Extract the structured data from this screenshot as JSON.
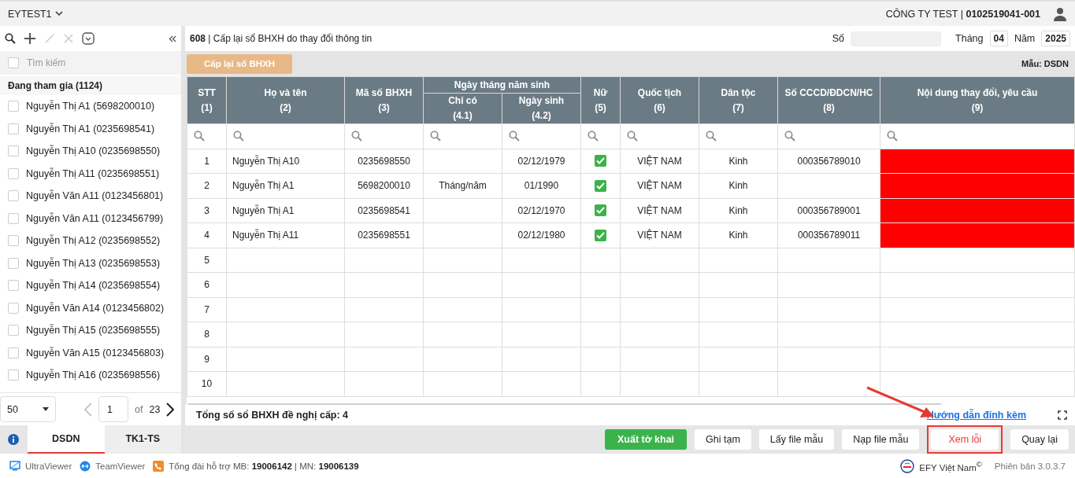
{
  "header": {
    "org_selector": "EYTEST1",
    "company": "CÔNG TY TEST | **0102519041-001**"
  },
  "sidebar": {
    "search_placeholder": "Tìm kiếm",
    "group": "Đang tham gia (1124)",
    "items": [
      {
        "label": "Nguyễn Thị A1 (5698200010)",
        "checked": false
      },
      {
        "label": "Nguyễn Thị A1 (0235698541)",
        "checked": false
      },
      {
        "label": "Nguyễn Thị A10 (0235698550)",
        "checked": false
      },
      {
        "label": "Nguyễn Thị A11 (0235698551)",
        "checked": false
      },
      {
        "label": "Nguyễn Văn A11 (0123456801)",
        "checked": false
      },
      {
        "label": "Nguyễn Văn A11 (0123456799)",
        "checked": false
      },
      {
        "label": "Nguyễn Thị A12 (0235698552)",
        "checked": false
      },
      {
        "label": "Nguyễn Thị A13 (0235698553)",
        "checked": false
      },
      {
        "label": "Nguyễn Thị A14 (0235698554)",
        "checked": false
      },
      {
        "label": "Nguyễn Văn A14 (0123456802)",
        "checked": false
      },
      {
        "label": "Nguyễn Thị A15 (0235698555)",
        "checked": false
      },
      {
        "label": "Nguyễn Văn A15 (0123456803)",
        "checked": false
      },
      {
        "label": "Nguyễn Thị A16 (0235698556)",
        "checked": false
      }
    ],
    "pager": {
      "page_size": "50",
      "page": "1",
      "of_label": "of",
      "total_pages": "23"
    }
  },
  "bottom_tabs": [
    {
      "label": "DSDN",
      "selected": true
    },
    {
      "label": "TK1-TS",
      "selected": false
    }
  ],
  "form": {
    "title": "**608** | Cấp lại sổ BHXH do thay đổi thông tin",
    "so_label": "Số",
    "thang_label": "Tháng",
    "thang": "04",
    "nam_label": "Năm",
    "nam": "2025",
    "action_button": "Cấp lại sổ BHXH",
    "template_label": "Mẫu: DSDN"
  },
  "table": {
    "columns": [
      {
        "label": "STT",
        "number": "(1)"
      },
      {
        "label": "Họ và tên",
        "number": "(2)"
      },
      {
        "label": "Mã số BHXH",
        "number": "(3)"
      },
      {
        "label": "Ngày tháng năm sinh",
        "children": [
          {
            "label": "Chỉ có",
            "number": "(4.1)"
          },
          {
            "label": "Ngày sinh",
            "number": "(4.2)"
          }
        ]
      },
      {
        "label": "Nữ",
        "number": "(5)"
      },
      {
        "label": "Quốc tịch",
        "number": "(6)"
      },
      {
        "label": "Dân tộc",
        "number": "(7)"
      },
      {
        "label": "Số CCCD/ĐDCN/HC",
        "number": "(8)"
      },
      {
        "label": "Nội dung thay đổi, yêu cầu",
        "number": "(9)"
      }
    ],
    "rows": [
      {
        "stt": "1",
        "name": "Nguyễn Thị A10",
        "bhxh": "0235698550",
        "dob": "02/12/1979",
        "female": true,
        "nationality": "VIỆT NAM",
        "ethnicity": "Kinh",
        "id_number": "000356789010",
        "flagged": true
      },
      {
        "stt": "2",
        "name": "Nguyễn Thị A1",
        "bhxh": "5698200010",
        "partial_date": "Tháng/năm",
        "dob": "01/1990",
        "female": true,
        "nationality": "VIỆT NAM",
        "ethnicity": "Kinh",
        "flagged": true
      },
      {
        "stt": "3",
        "name": "Nguyễn Thị A1",
        "bhxh": "0235698541",
        "dob": "02/12/1970",
        "female": true,
        "nationality": "VIỆT NAM",
        "ethnicity": "Kinh",
        "id_number": "000356789001",
        "flagged": true
      },
      {
        "stt": "4",
        "name": "Nguyễn Thị A11",
        "bhxh": "0235698551",
        "dob": "02/12/1980",
        "female": true,
        "nationality": "VIỆT NAM",
        "ethnicity": "Kinh",
        "id_number": "000356789011",
        "flagged": true
      },
      {
        "stt": "5",
        "female": false,
        "flagged": false
      },
      {
        "stt": "6",
        "female": false,
        "flagged": false
      },
      {
        "stt": "7",
        "female": false,
        "flagged": false
      },
      {
        "stt": "8",
        "female": false,
        "flagged": false
      },
      {
        "stt": "9",
        "female": false,
        "flagged": false
      },
      {
        "stt": "10",
        "female": false,
        "flagged": false
      }
    ],
    "total": "Tổng số sổ BHXH đề nghị cấp: 4",
    "guide_link": "Hướng dẫn đính kèm"
  },
  "actions": [
    {
      "label": "Xuất tờ khai",
      "kind": "primary",
      "highlighted": false
    },
    {
      "label": "Ghi tạm",
      "kind": "default",
      "highlighted": false
    },
    {
      "label": "Lấy file mẫu",
      "kind": "default",
      "highlighted": false
    },
    {
      "label": "Nạp file mẫu",
      "kind": "default",
      "highlighted": false
    },
    {
      "label": "Xem lỗi",
      "kind": "danger",
      "highlighted": true
    },
    {
      "label": "Quay lại",
      "kind": "default",
      "highlighted": false
    }
  ],
  "footer": {
    "links": [
      {
        "label": "UltraViewer",
        "kind": "monitor"
      },
      {
        "label": "TeamViewer",
        "kind": "remote"
      }
    ],
    "hotline": "Tổng đài hỗ trợ MB: **19006142** | MN: **19006139**",
    "brand": "EFY Việt Nam$^{©}$",
    "version": "Phiên bản 3.0.3.7"
  }
}
